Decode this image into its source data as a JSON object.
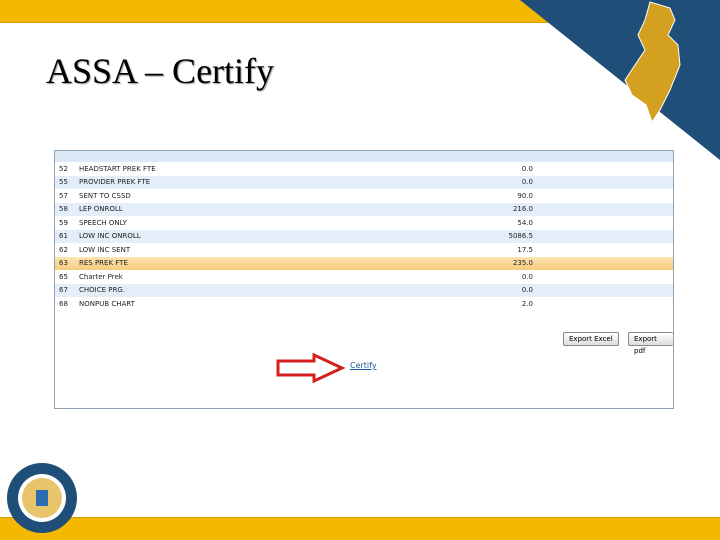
{
  "slide": {
    "title": "ASSA – Certify"
  },
  "table": {
    "rows": [
      {
        "num": "52",
        "label": "HEADSTART PREK FTE",
        "value": "0.0"
      },
      {
        "num": "55",
        "label": "PROVIDER PREK FTE",
        "value": "0.0"
      },
      {
        "num": "57",
        "label": "SENT TO CSSD",
        "value": "90.0"
      },
      {
        "num": "58",
        "label": "LEP ONROLL",
        "value": "216.0"
      },
      {
        "num": "59",
        "label": "SPEECH ONLY",
        "value": "54.0"
      },
      {
        "num": "61",
        "label": "LOW INC ONROLL",
        "value": "5086.5"
      },
      {
        "num": "62",
        "label": "LOW INC SENT",
        "value": "17.5"
      },
      {
        "num": "63",
        "label": "RES PREK FTE",
        "value": "235.0"
      },
      {
        "num": "65",
        "label": "Charter Prek",
        "value": "0.0"
      },
      {
        "num": "67",
        "label": "CHOICE PRG.",
        "value": "0.0"
      },
      {
        "num": "68",
        "label": "NONPUB CHART",
        "value": "2.0"
      }
    ]
  },
  "buttons": {
    "export_excel": "Export Excel",
    "export_pdf": "Export pdf",
    "certify": "Certify"
  },
  "selected_row": 7
}
